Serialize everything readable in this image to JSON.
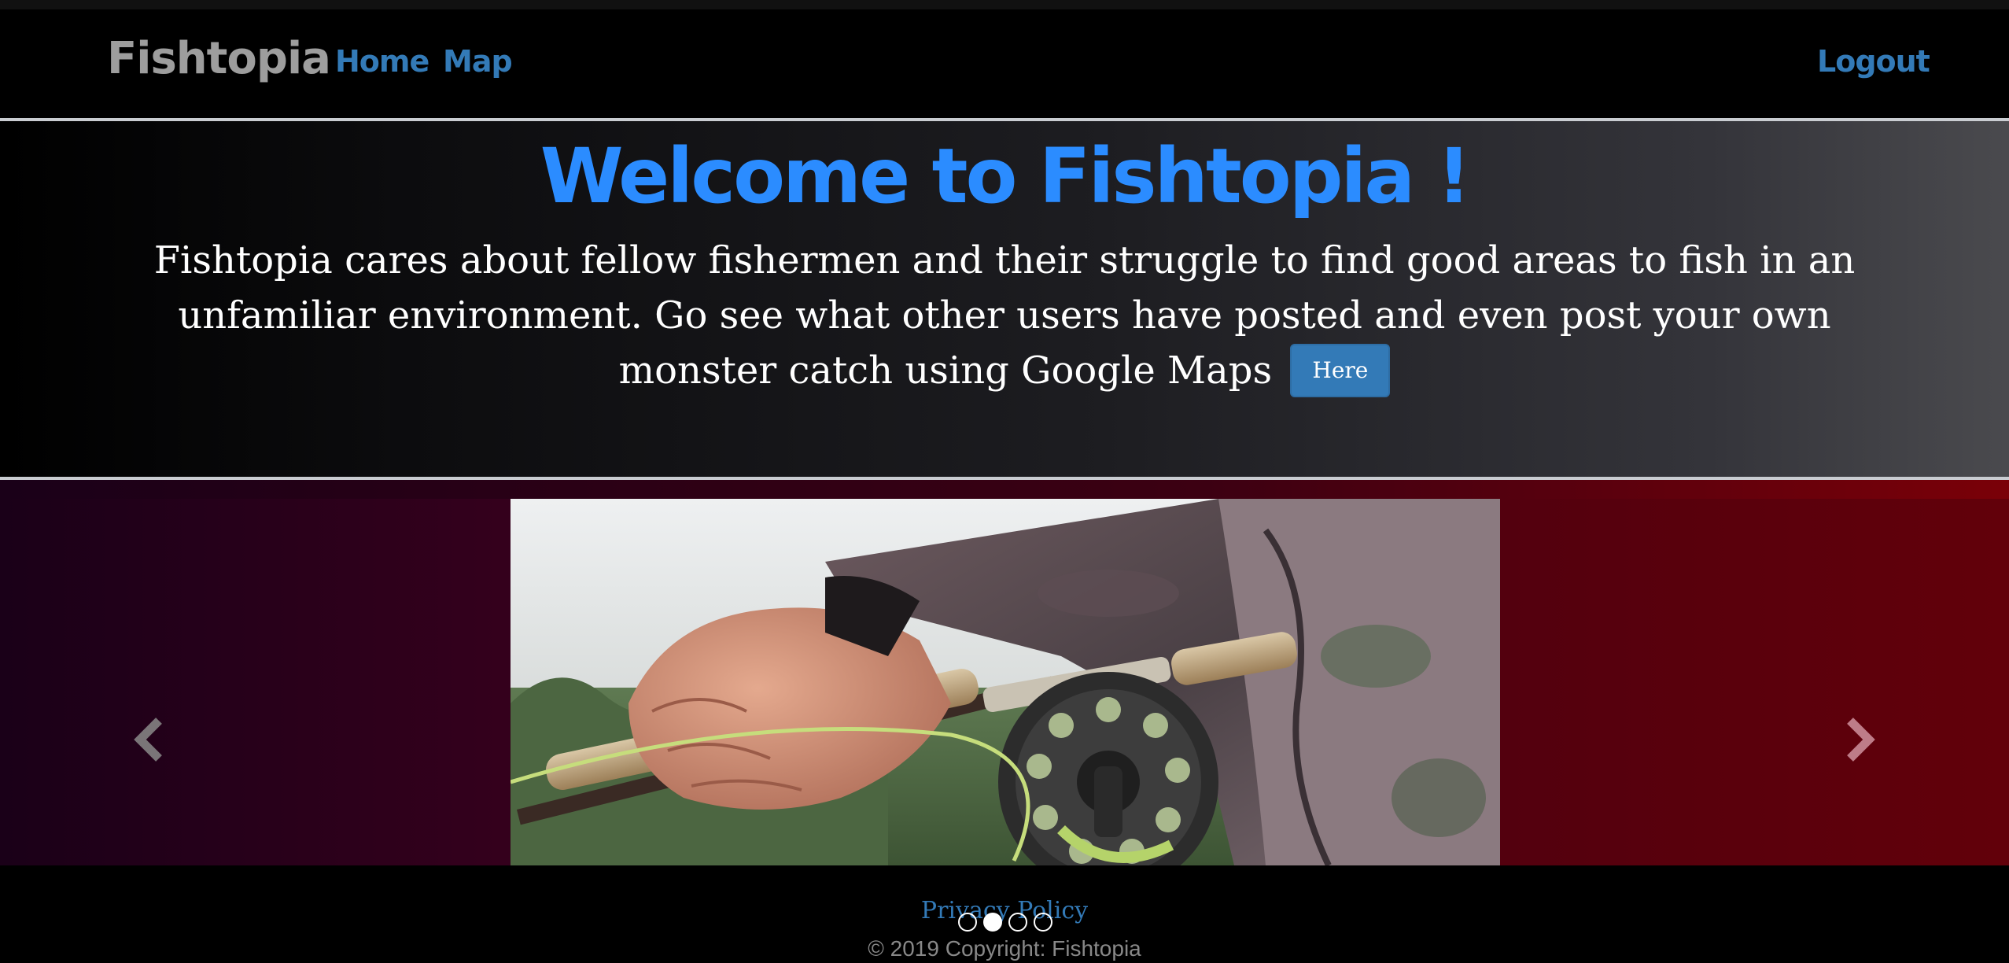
{
  "navbar": {
    "brand": "Fishtopia",
    "links": {
      "home": "Home",
      "map": "Map"
    },
    "logout": "Logout"
  },
  "hero": {
    "title": "Welcome to Fishtopia !",
    "text": "Fishtopia cares about fellow fishermen and their struggle to find good areas to fish in an unfamiliar environment. Go see what other users have posted and even post your own monster catch using Google Maps",
    "button": "Here"
  },
  "carousel": {
    "slide_count": 4,
    "active_index": 1,
    "controls": {
      "prev_icon": "chevron-left-icon",
      "next_icon": "chevron-right-icon"
    }
  },
  "footer": {
    "privacy": "Privacy Policy",
    "copyright": "© 2019 Copyright: Fishtopia"
  },
  "colors": {
    "accent": "#337ab7",
    "title": "#2b8cff",
    "brand": "#9d9d9d"
  }
}
